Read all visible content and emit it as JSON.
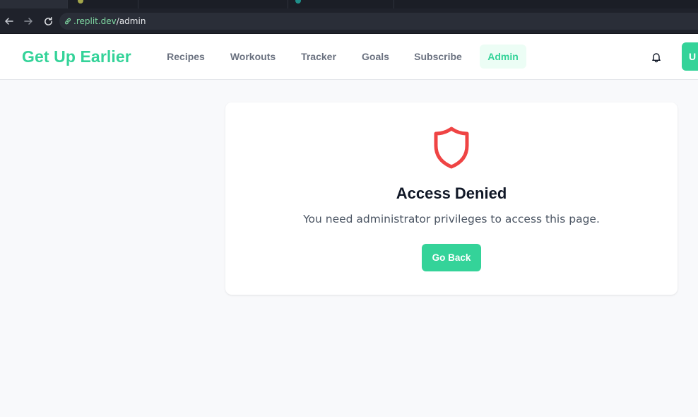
{
  "browser": {
    "url_host": ".replit.dev",
    "url_path": "/admin"
  },
  "header": {
    "brand": "Get Up Earlier",
    "nav": [
      {
        "label": "Recipes"
      },
      {
        "label": "Workouts"
      },
      {
        "label": "Tracker"
      },
      {
        "label": "Goals"
      },
      {
        "label": "Subscribe"
      },
      {
        "label": "Admin",
        "active": true
      }
    ],
    "user_initial": "U"
  },
  "card": {
    "title": "Access Denied",
    "message": "You need administrator privileges to access this page.",
    "button_label": "Go Back"
  },
  "colors": {
    "accent": "#34d399",
    "danger": "#ef4444"
  },
  "icons": {
    "bell": "bell-icon",
    "shield": "shield-icon",
    "link": "link-icon"
  }
}
